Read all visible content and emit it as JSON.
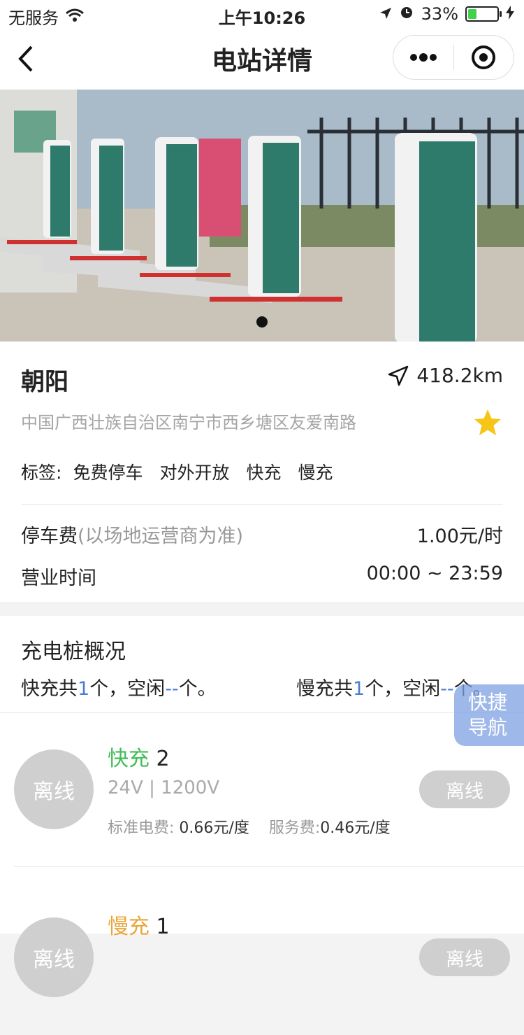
{
  "status_bar": {
    "carrier": "无服务",
    "time": "上午10:26",
    "battery": "33%",
    "battery_level": 0.33
  },
  "nav": {
    "title": "电站详情"
  },
  "station": {
    "name": "朝阳",
    "distance": "418.2km",
    "address": "中国广西壮族自治区南宁市西乡塘区友爱南路",
    "tags_label": "标签:",
    "tags": [
      "免费停车",
      "对外开放",
      "快充",
      "慢充"
    ],
    "parking_label": "停车费",
    "parking_note": "(以场地运营商为准)",
    "parking_fee": "1.00元/时",
    "hours_label": "营业时间",
    "hours": "00:00 ~ 23:59"
  },
  "overview": {
    "title": "充电桩概况",
    "fast": {
      "prefix": "快充共",
      "count": "1",
      "mid": "个，空闲",
      "idle": "--",
      "suffix": "个。"
    },
    "slow": {
      "prefix": "慢充共",
      "count": "1",
      "mid": "个，空闲",
      "idle": "--",
      "suffix": "个。"
    }
  },
  "quick_nav": {
    "line1": "快捷",
    "line2": "导航"
  },
  "chargers": [
    {
      "status": "离线",
      "type": "快充",
      "number": "2",
      "voltage": "24V | 1200V",
      "std_fee_label": "标准电费:",
      "std_fee": "0.66元/度",
      "service_fee_label": "服务费:",
      "service_fee": "0.46元/度",
      "button": "离线"
    },
    {
      "status": "离线",
      "type": "慢充",
      "number": "1",
      "button": "离线"
    }
  ],
  "colors": {
    "fast": "#3fbd56",
    "slow": "#e9a53a",
    "accent_blue": "#4a7bd6",
    "star": "#f5c518"
  }
}
